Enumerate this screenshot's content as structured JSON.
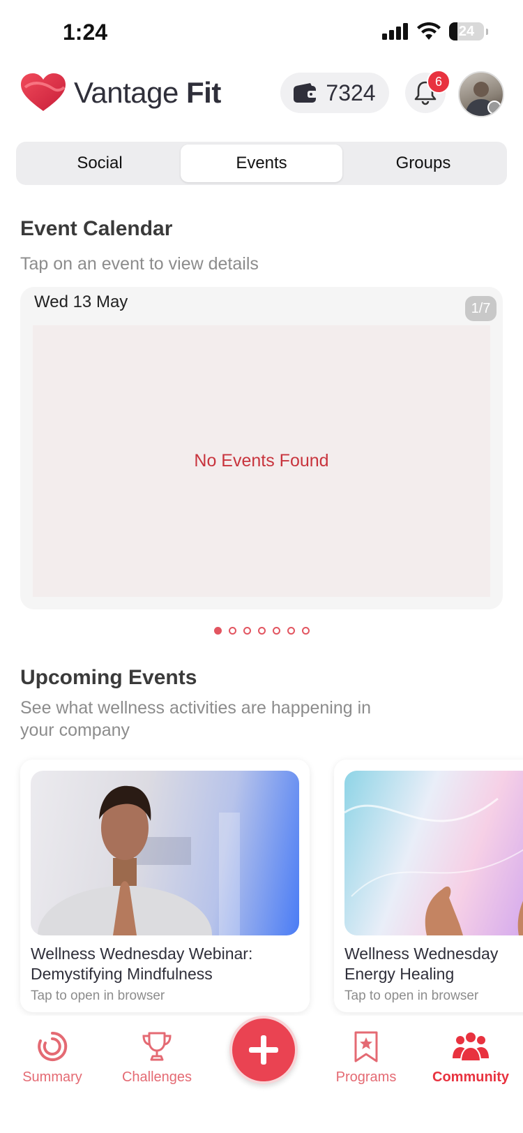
{
  "status": {
    "time": "1:24",
    "battery": "24"
  },
  "header": {
    "brand_first": "Vantage ",
    "brand_second": "Fit",
    "wallet_points": "7324",
    "notifications_count": "6"
  },
  "tabs": [
    {
      "label": "Social"
    },
    {
      "label": "Events"
    },
    {
      "label": "Groups"
    }
  ],
  "event_calendar": {
    "title": "Event Calendar",
    "subtitle": "Tap on an event to view details",
    "date": "Wed 13 May",
    "page_indicator": "1/7",
    "empty_message": "No Events Found"
  },
  "upcoming": {
    "title": "Upcoming Events",
    "subtitle_line1": "See what wellness activities are happening in",
    "subtitle_line2": "your company",
    "events": [
      {
        "title_line1": "Wellness Wednesday Webinar:",
        "title_line2": "Demystifying Mindfulness",
        "action": "Tap to open in browser"
      },
      {
        "title_line1": "Wellness Wednesday",
        "title_line2": "Energy Healing",
        "action": "Tap to open in browser"
      }
    ]
  },
  "bottom_nav": {
    "items": [
      {
        "label": "Summary"
      },
      {
        "label": "Challenges"
      },
      {
        "label": "Programs"
      },
      {
        "label": "Community"
      }
    ]
  },
  "colors": {
    "accent": "#e8323f",
    "nav_inactive": "#e46a73",
    "empty_bg": "#f3eded"
  }
}
